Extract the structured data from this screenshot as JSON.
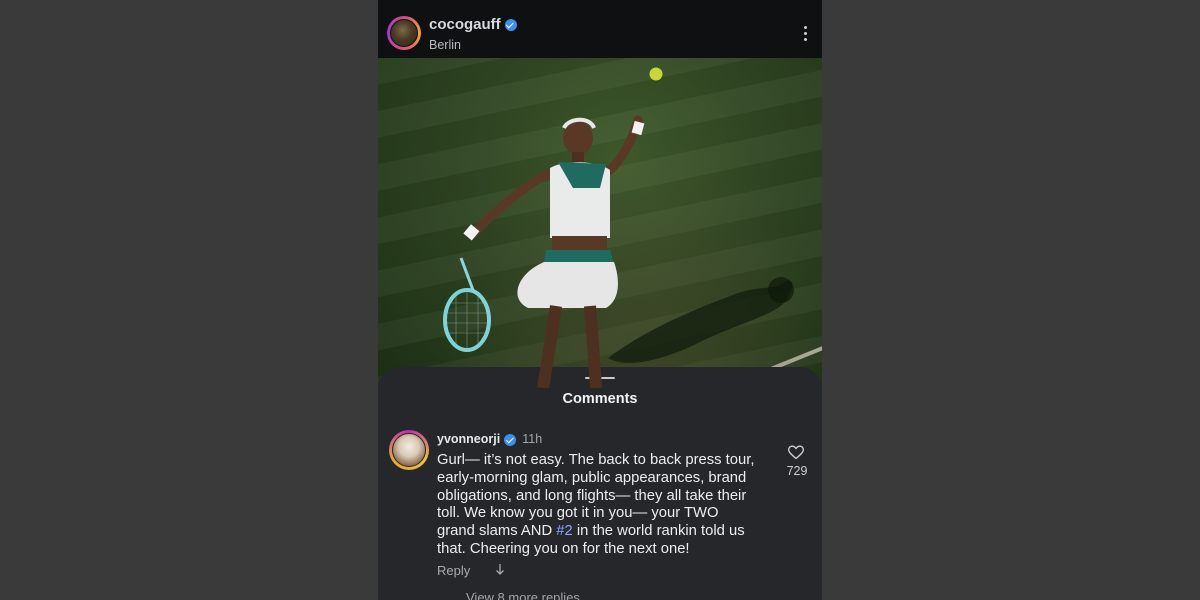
{
  "post": {
    "username": "cocogauff",
    "location": "Berlin",
    "verified": true
  },
  "photo": {
    "description_icon": "photo-image"
  },
  "comments_sheet": {
    "title": "Comments",
    "comment": {
      "username": "yvonneorji",
      "time": "11h",
      "text_before": "Gurl— it’s not easy. The back to back press tour,\nearly-morning glam, public appearances, brand\nobligations, and long flights— they all take their\ntoll. We know you got it in you— your TWO\ngrand slams AND ",
      "hashtag": "#2",
      "text_after": " in the world rankin told us\nthat. Cheering you on for the next one!",
      "like_count": "729",
      "reply_label": "Reply",
      "view_replies": "View 8 more replies"
    }
  },
  "colors": {
    "background": "#3a3a3b",
    "sheet": "#25272b",
    "verified_blue": "#3d8ef0",
    "hashtag": "#8fa6ff"
  }
}
